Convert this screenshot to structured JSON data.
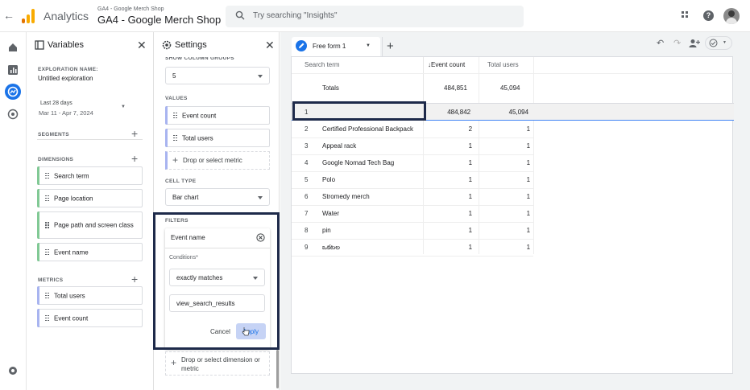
{
  "topbar": {
    "app_name": "Analytics",
    "account_small": "GA4 - Google Merch Shop",
    "account_big": "GA4 - Google Merch Shop",
    "search_placeholder": "Try searching \"Insights\""
  },
  "variables": {
    "title": "Variables",
    "exploration_name_label": "EXPLORATION NAME:",
    "exploration_name": "Untitled exploration",
    "date_label": "Last 28 days",
    "date_range": "Mar 11 - Apr 7, 2024",
    "segments_label": "SEGMENTS",
    "dimensions_label": "DIMENSIONS",
    "dimensions": [
      "Search term",
      "Page location",
      "Page path and screen class",
      "Event name"
    ],
    "metrics_label": "METRICS",
    "metrics": [
      "Total users",
      "Event count"
    ]
  },
  "settings": {
    "title": "Settings",
    "show_column_groups_label": "SHOW COLUMN GROUPS",
    "show_column_groups_value": "5",
    "values_label": "VALUES",
    "values": [
      "Event count",
      "Total users"
    ],
    "drop_metric": "Drop or select metric",
    "cell_type_label": "CELL TYPE",
    "cell_type_value": "Bar chart",
    "filters_label": "FILTERS",
    "filter_dimension": "Event name",
    "conditions_label": "Conditions*",
    "condition_value": "exactly matches",
    "expression_value": "view_search_results",
    "cancel_label": "Cancel",
    "apply_label": "Apply",
    "drop_dim_metric": "Drop or select dimension or metric"
  },
  "tabs": {
    "active_tab": "Free form 1",
    "add_tab": "+"
  },
  "table": {
    "headers": [
      "Search term",
      "↓Event count",
      "Total users"
    ],
    "totals_label": "Totals",
    "totals": [
      "484,851",
      "45,094"
    ],
    "rows": [
      {
        "n": "1",
        "term": "",
        "events": "484,842",
        "users": "45,094"
      },
      {
        "n": "2",
        "term": "Certified Professional Backpack",
        "events": "2",
        "users": "1"
      },
      {
        "n": "3",
        "term": "Appeal rack",
        "events": "1",
        "users": "1"
      },
      {
        "n": "4",
        "term": "Google Nomad Tech Bag",
        "events": "1",
        "users": "1"
      },
      {
        "n": "5",
        "term": "Polo",
        "events": "1",
        "users": "1"
      },
      {
        "n": "6",
        "term": "Stromedy merch",
        "events": "1",
        "users": "1"
      },
      {
        "n": "7",
        "term": "Water",
        "events": "1",
        "users": "1"
      },
      {
        "n": "8",
        "term": "pin",
        "events": "1",
        "users": "1"
      },
      {
        "n": "9",
        "term": "ఒకటల",
        "events": "1",
        "users": "1"
      }
    ]
  },
  "colors": {
    "accent": "#1a73e8",
    "dimension_bar": "#81c995",
    "metric_bar": "#a8b4f0",
    "highlight": "#1e2a4a"
  }
}
